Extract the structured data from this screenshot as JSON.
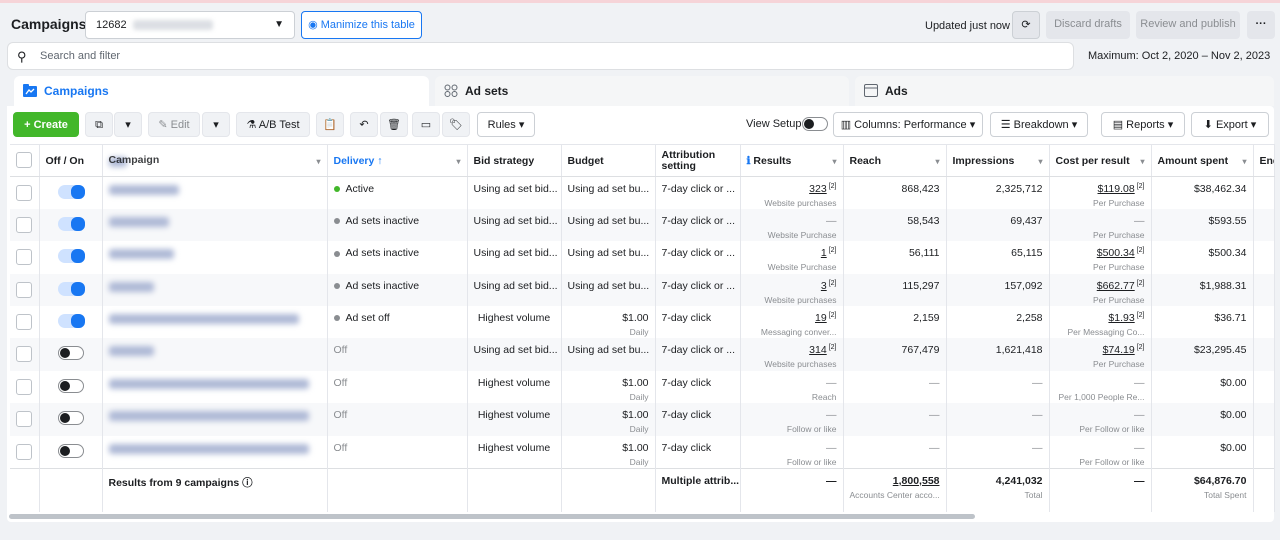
{
  "header": {
    "title": "Campaigns",
    "account_prefix": "12682",
    "minimize_label": "Manimize this table",
    "updated": "Updated just now",
    "discard": "Discard drafts",
    "review": "Review and publish",
    "more": "···"
  },
  "search": {
    "placeholder": "Search and filter"
  },
  "daterange": "Maximum: Oct 2, 2020 – Nov 2, 2023",
  "tabs": [
    {
      "label": "Campaigns"
    },
    {
      "label": "Ad sets"
    },
    {
      "label": "Ads"
    }
  ],
  "toolbar": {
    "create": "Create",
    "edit": "Edit",
    "abtest": "A/B Test",
    "rules": "Rules",
    "view_setup": "View Setup",
    "columns": "Columns: Performance",
    "breakdown": "Breakdown",
    "reports": "Reports",
    "export": "Export"
  },
  "columns": [
    "Off / On",
    "Campaign",
    "Delivery ↑",
    "Bid strategy",
    "Budget",
    "Attribution setting",
    "Results",
    "Reach",
    "Impressions",
    "Cost per result",
    "Amount spent",
    "End"
  ],
  "rows": [
    {
      "on": true,
      "name_w": 70,
      "delivery": "Active",
      "delivery_color": "#42b72a",
      "bid": "Using ad set bid...",
      "budget": "Using ad set bu...",
      "budget_sub": "",
      "attr": "7-day click or ...",
      "results": "323",
      "results_sub": "Website purchases",
      "reach": "868,423",
      "impr": "2,325,712",
      "cpr": "$119.08",
      "cpr_sub": "Per Purchase",
      "spent": "$38,462.34"
    },
    {
      "on": true,
      "name_w": 60,
      "delivery": "Ad sets inactive",
      "delivery_color": "#8a8d91",
      "bid": "Using ad set bid...",
      "budget": "Using ad set bu...",
      "budget_sub": "",
      "attr": "7-day click or ...",
      "results": "—",
      "results_sub": "Website Purchase",
      "reach": "58,543",
      "impr": "69,437",
      "cpr": "—",
      "cpr_sub": "Per Purchase",
      "spent": "$593.55"
    },
    {
      "on": true,
      "name_w": 65,
      "delivery": "Ad sets inactive",
      "delivery_color": "#8a8d91",
      "bid": "Using ad set bid...",
      "budget": "Using ad set bu...",
      "budget_sub": "",
      "attr": "7-day click or ...",
      "results": "1",
      "results_sub": "Website Purchase",
      "reach": "56,111",
      "impr": "65,115",
      "cpr": "$500.34",
      "cpr_sub": "Per Purchase",
      "spent": "$500.34"
    },
    {
      "on": true,
      "name_w": 45,
      "delivery": "Ad sets inactive",
      "delivery_color": "#8a8d91",
      "bid": "Using ad set bid...",
      "budget": "Using ad set bu...",
      "budget_sub": "",
      "attr": "7-day click or ...",
      "results": "3",
      "results_sub": "Website purchases",
      "reach": "115,297",
      "impr": "157,092",
      "cpr": "$662.77",
      "cpr_sub": "Per Purchase",
      "spent": "$1,988.31"
    },
    {
      "on": true,
      "name_w": 190,
      "delivery": "Ad set off",
      "delivery_color": "#8a8d91",
      "bid": "Highest volume",
      "budget": "$1.00",
      "budget_sub": "Daily",
      "attr": "7-day click",
      "results": "19",
      "results_sub": "Messaging conver...",
      "reach": "2,159",
      "impr": "2,258",
      "cpr": "$1.93",
      "cpr_sub": "Per Messaging Co...",
      "spent": "$36.71"
    },
    {
      "on": false,
      "name_w": 45,
      "delivery": "Off",
      "delivery_color": "",
      "bid": "Using ad set bid...",
      "budget": "Using ad set bu...",
      "budget_sub": "",
      "attr": "7-day click or ...",
      "results": "314",
      "results_sub": "Website purchases",
      "reach": "767,479",
      "impr": "1,621,418",
      "cpr": "$74.19",
      "cpr_sub": "Per Purchase",
      "spent": "$23,295.45"
    },
    {
      "on": false,
      "name_w": 200,
      "delivery": "Off",
      "delivery_color": "",
      "bid": "Highest volume",
      "budget": "$1.00",
      "budget_sub": "Daily",
      "attr": "7-day click",
      "results": "—",
      "results_sub": "Reach",
      "reach": "—",
      "impr": "—",
      "cpr": "—",
      "cpr_sub": "Per 1,000 People Re...",
      "spent": "$0.00"
    },
    {
      "on": false,
      "name_w": 200,
      "delivery": "Off",
      "delivery_color": "",
      "bid": "Highest volume",
      "budget": "$1.00",
      "budget_sub": "Daily",
      "attr": "7-day click",
      "results": "—",
      "results_sub": "Follow or like",
      "reach": "—",
      "impr": "—",
      "cpr": "—",
      "cpr_sub": "Per Follow or like",
      "spent": "$0.00"
    },
    {
      "on": false,
      "name_w": 200,
      "delivery": "Off",
      "delivery_color": "",
      "bid": "Highest volume",
      "budget": "$1.00",
      "budget_sub": "Daily",
      "attr": "7-day click",
      "results": "—",
      "results_sub": "Follow or like",
      "reach": "—",
      "impr": "—",
      "cpr": "—",
      "cpr_sub": "Per Follow or like",
      "spent": "$0.00"
    }
  ],
  "footer": {
    "label": "Results from 9 campaigns",
    "attr": "Multiple attrib...",
    "results": "—",
    "reach": "1,800,558",
    "reach_sub": "Accounts Center acco...",
    "impr": "4,241,032",
    "impr_sub": "Total",
    "cpr": "—",
    "spent": "$64,876.70",
    "spent_sub": "Total Spent"
  }
}
